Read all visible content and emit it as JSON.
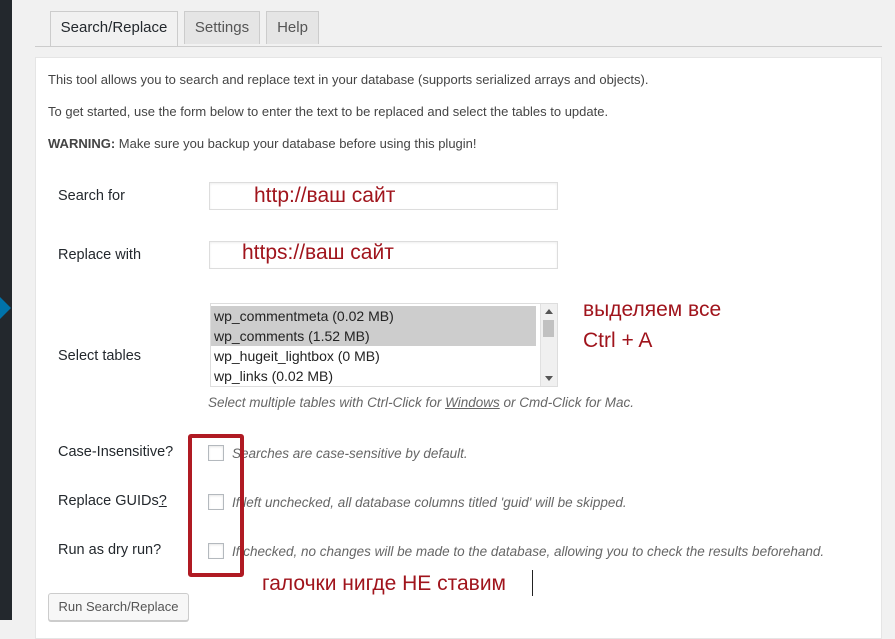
{
  "tabs": [
    {
      "label": "Search/Replace",
      "active": true
    },
    {
      "label": "Settings",
      "active": false
    },
    {
      "label": "Help",
      "active": false
    }
  ],
  "intro": {
    "line1": "This tool allows you to search and replace text in your database (supports serialized arrays and objects).",
    "line2": "To get started, use the form below to enter the text to be replaced and select the tables to update.",
    "warning_label": "WARNING:",
    "warning_text": " Make sure you backup your database before using this plugin!"
  },
  "form": {
    "search_label": "Search for",
    "search_value": "",
    "replace_label": "Replace with",
    "replace_value": "",
    "tables_label": "Select tables",
    "tables": [
      {
        "name": "wp_commentmeta (0.02 MB)",
        "selected": true
      },
      {
        "name": "wp_comments (1.52 MB)",
        "selected": true
      },
      {
        "name": "wp_hugeit_lightbox (0 MB)",
        "selected": false
      },
      {
        "name": "wp_links (0.02 MB)",
        "selected": false
      }
    ],
    "tables_hint_pre": "Select multiple tables with Ctrl-Click for ",
    "tables_hint_link": "Windows",
    "tables_hint_post": " or Cmd-Click for Mac.",
    "case_label": "Case-Insensitive?",
    "case_hint": "Searches are case-sensitive by default.",
    "case_checked": false,
    "guids_label": "Replace GUIDs",
    "guids_link": "?",
    "guids_hint": "If left unchecked, all database columns titled 'guid' will be skipped.",
    "guids_checked": false,
    "dry_label": "Run as dry run?",
    "dry_hint": "If checked, no changes will be made to the database, allowing you to check the results beforehand.",
    "dry_checked": false,
    "submit_label": "Run Search/Replace"
  },
  "annotations": {
    "search": "http://ваш сайт",
    "replace": "https://ваш сайт",
    "select_all_1": "выделяем все",
    "select_all_2": "Ctrl + A",
    "no_checks": "галочки нигде НЕ ставим"
  },
  "colors": {
    "annotation_red": "#a0141c",
    "wp_blue": "#0073aa"
  }
}
